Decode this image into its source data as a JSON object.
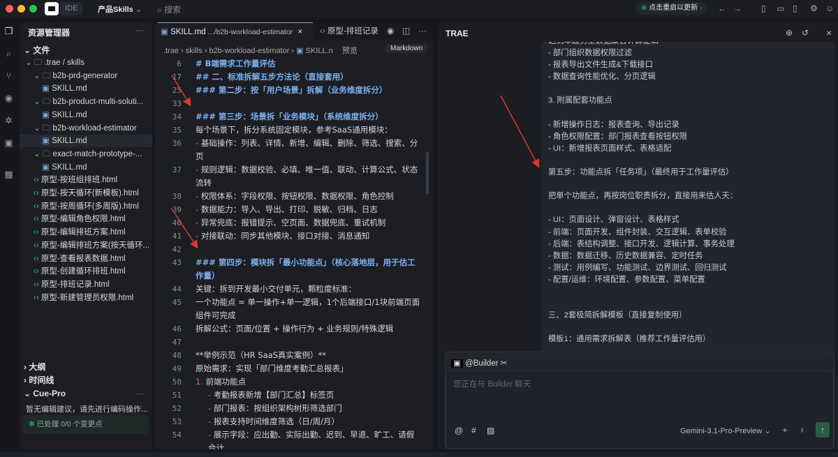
{
  "topbar": {
    "app": "IDE",
    "project": "产品Skills",
    "search_placeholder": "搜索",
    "update": "点击重启以更新"
  },
  "explorer": {
    "title": "资源管理器",
    "more": "···",
    "section": "文件",
    "tree": [
      {
        "label": ".trae / skills",
        "kind": "folder",
        "depth": 0
      },
      {
        "label": "b2b-prd-generator",
        "kind": "folder",
        "depth": 1
      },
      {
        "label": "SKILL.md",
        "kind": "md",
        "depth": 2
      },
      {
        "label": "b2b-product-multi-soluti...",
        "kind": "folder",
        "depth": 1
      },
      {
        "label": "SKILL.md",
        "kind": "md",
        "depth": 2
      },
      {
        "label": "b2b-workload-estimator",
        "kind": "folder",
        "depth": 1
      },
      {
        "label": "SKILL.md",
        "kind": "md",
        "depth": 2,
        "selected": true
      },
      {
        "label": "exact-match-prototype-...",
        "kind": "folder",
        "depth": 1
      },
      {
        "label": "SKILL.md",
        "kind": "md",
        "depth": 2
      },
      {
        "label": "原型-按班组排班.html",
        "kind": "html",
        "depth": 1
      },
      {
        "label": "原型-按天循环(新模板).html",
        "kind": "html",
        "depth": 1
      },
      {
        "label": "原型-按周循环(多周版).html",
        "kind": "html",
        "depth": 1
      },
      {
        "label": "原型-编辑角色权限.html",
        "kind": "html",
        "depth": 1
      },
      {
        "label": "原型-编辑排班方案.html",
        "kind": "html",
        "depth": 1
      },
      {
        "label": "原型-编辑排班方案(按天循环...",
        "kind": "html",
        "depth": 1
      },
      {
        "label": "原型-查看报表数据.html",
        "kind": "html",
        "depth": 1
      },
      {
        "label": "原型-创建循环排班.html",
        "kind": "html",
        "depth": 1
      },
      {
        "label": "原型-排班记录.html",
        "kind": "html",
        "depth": 1
      },
      {
        "label": "原型-新建管理员权限.html",
        "kind": "html",
        "depth": 1
      }
    ],
    "outline": "大纲",
    "timeline": "时间线",
    "cue_title": "Cue-Pro",
    "cue_text": "暂无编辑建议，请先进行编码操作...",
    "cue_status": "已处理 0/0 个变更点"
  },
  "editor": {
    "tab_active": "SKILL.md",
    "tab_active_path": ".../b2b-workload-estimator",
    "tab2": "原型-排班记录",
    "crumbs": [
      ".trae",
      "skills",
      "b2b-workload-estimator",
      "SKILL.n"
    ],
    "preview": "预览",
    "markdown": "Markdown",
    "lines": [
      {
        "n": "6",
        "t": "# B端需求工作量评估",
        "k": "h"
      },
      {
        "n": "17",
        "t": "## 二、标准拆解五步方法论（直接套用）",
        "k": "h"
      },
      {
        "n": "25",
        "t": "### 第二步：按「用户场景」拆解（业务维度拆分）",
        "k": "h"
      },
      {
        "n": "33",
        "t": "",
        "k": ""
      },
      {
        "n": "34",
        "t": "### 第三步：场景拆「业务模块」（系统维度拆分）",
        "k": "h"
      },
      {
        "n": "35",
        "t": "每个场景下，拆分系统固定模块，参考SaaS通用模块：",
        "k": ""
      },
      {
        "n": "36",
        "t": "基础操作：列表、详情、新增、编辑、删除、筛选、搜索、分页",
        "k": "li"
      },
      {
        "n": "37",
        "t": "规则逻辑：数据校验、必填、唯一值、联动、计算公式、状态流转",
        "k": "li"
      },
      {
        "n": "38",
        "t": "权限体系：字段权限、按钮权限、数据权限、角色控制",
        "k": "li"
      },
      {
        "n": "39",
        "t": "数据能力：导入、导出、打印、脱敏、归档、日志",
        "k": "li"
      },
      {
        "n": "40",
        "t": "异常兜底：报错提示、空页面、数据兜底、重试机制",
        "k": "li"
      },
      {
        "n": "41",
        "t": "对接联动：同步其他模块、接口对接、消息通知",
        "k": "li"
      },
      {
        "n": "42",
        "t": "",
        "k": ""
      },
      {
        "n": "43",
        "t": "### 第四步：模块拆「最小功能点」（核心落地层，用于估工作量）",
        "k": "h"
      },
      {
        "n": "44",
        "t": "关键：拆到开发最小交付单元，颗粒度标准：",
        "k": ""
      },
      {
        "n": "45",
        "t": "一个功能点 = 单一操作+单一逻辑，1个后端接口/1块前端页面组件可完成",
        "k": ""
      },
      {
        "n": "46",
        "t": "拆解公式：页面/位置 + 操作行为 + 业务规则/特殊逻辑",
        "k": ""
      },
      {
        "n": "47",
        "t": "",
        "k": ""
      },
      {
        "n": "48",
        "t": "**举例示范（HR SaaS真实案例）**",
        "k": ""
      },
      {
        "n": "49",
        "t": "原始需求：实现「部门维度考勤汇总报表」",
        "k": ""
      },
      {
        "n": "50",
        "t": "前端功能点",
        "k": "ol"
      },
      {
        "n": "51",
        "t": "考勤报表新增【部门汇总】标签页",
        "k": "sub"
      },
      {
        "n": "52",
        "t": "部门报表：按组织架构树形筛选部门",
        "k": "sub"
      },
      {
        "n": "53",
        "t": "报表支持时间维度筛选（日/周/月）",
        "k": "sub"
      },
      {
        "n": "54",
        "t": "展示字段：应出勤、实际出勤、迟到、早退、旷工、请假合计",
        "k": "sub"
      }
    ]
  },
  "chat": {
    "title": "TRAE",
    "messages": [
      "迟到率趋势工数据聚合计算逻辑",
      "- 部门组织数据权限过滤",
      "- 报表导出文件生成&下载接口",
      "- 数据查询性能优化、分页逻辑",
      "",
      "3. 附属配套功能点",
      "",
      "- 新增操作日志：报表查询、导出记录",
      "- 角色权限配置：部门报表查看按钮权限",
      "- UI：新增报表页面样式、表格适配",
      "",
      "第五步：功能点拆「任务项」（最终用于工作量评估）",
      "",
      "把单个功能点，再按岗位职责拆分，直接用来估人天：",
      "",
      "- UI：页面设计、弹窗设计、表格样式",
      "- 前端：页面开发、组件封装、交互逻辑、表单校验",
      "- 后端：表结构调整、接口开发、逻辑计算、事务处理",
      "- 数据：数据迁移、历史数据兼容、定时任务",
      "- 测试：用例编写、功能测试、边界测试、回归测试",
      "- 配置/运维：环境配置、参数配置、菜单配置",
      "",
      "",
      "三、2套极简拆解模板（直接复制使用）",
      "",
      "模板1：通用需求拆解表（推荐工作量评估用）"
    ],
    "agent": "@Builder",
    "placeholder": "您正在与 Builder 聊天",
    "model": "Gemini-3.1-Pro-Preview"
  }
}
